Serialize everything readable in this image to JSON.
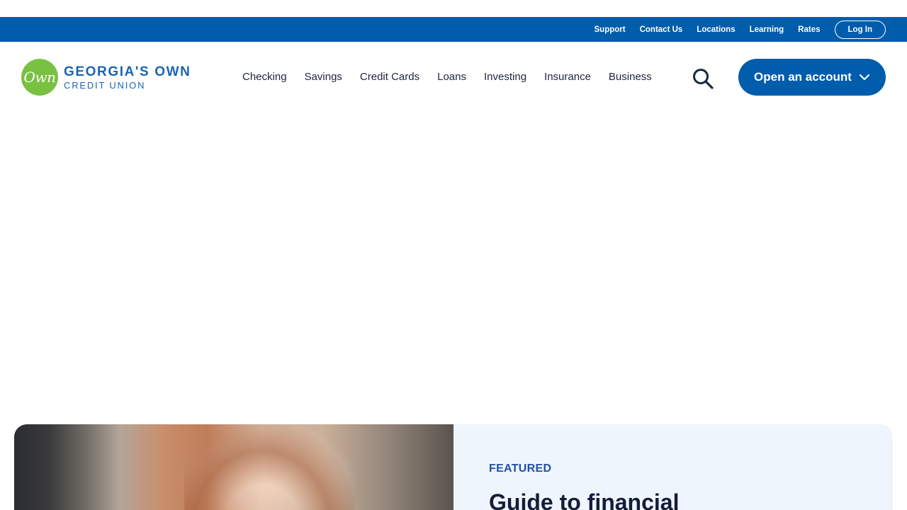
{
  "utility_nav": {
    "links": [
      "Support",
      "Contact Us",
      "Locations",
      "Learning",
      "Rates"
    ],
    "login_label": "Log In"
  },
  "brand": {
    "logo_mark": "Own",
    "name": "GEORGIA'S OWN",
    "sub": "CREDIT UNION"
  },
  "main_nav": {
    "items": [
      "Checking",
      "Savings",
      "Credit Cards",
      "Loans",
      "Investing",
      "Insurance",
      "Business"
    ],
    "search_icon": "search-icon",
    "cta_label": "Open an account"
  },
  "featured": {
    "eyebrow": "FEATURED",
    "title": "Guide to financial"
  },
  "colors": {
    "primary": "#005dab",
    "logo_green": "#7ac143",
    "card_bg": "#eef5fd",
    "text_dark": "#1c2640"
  }
}
